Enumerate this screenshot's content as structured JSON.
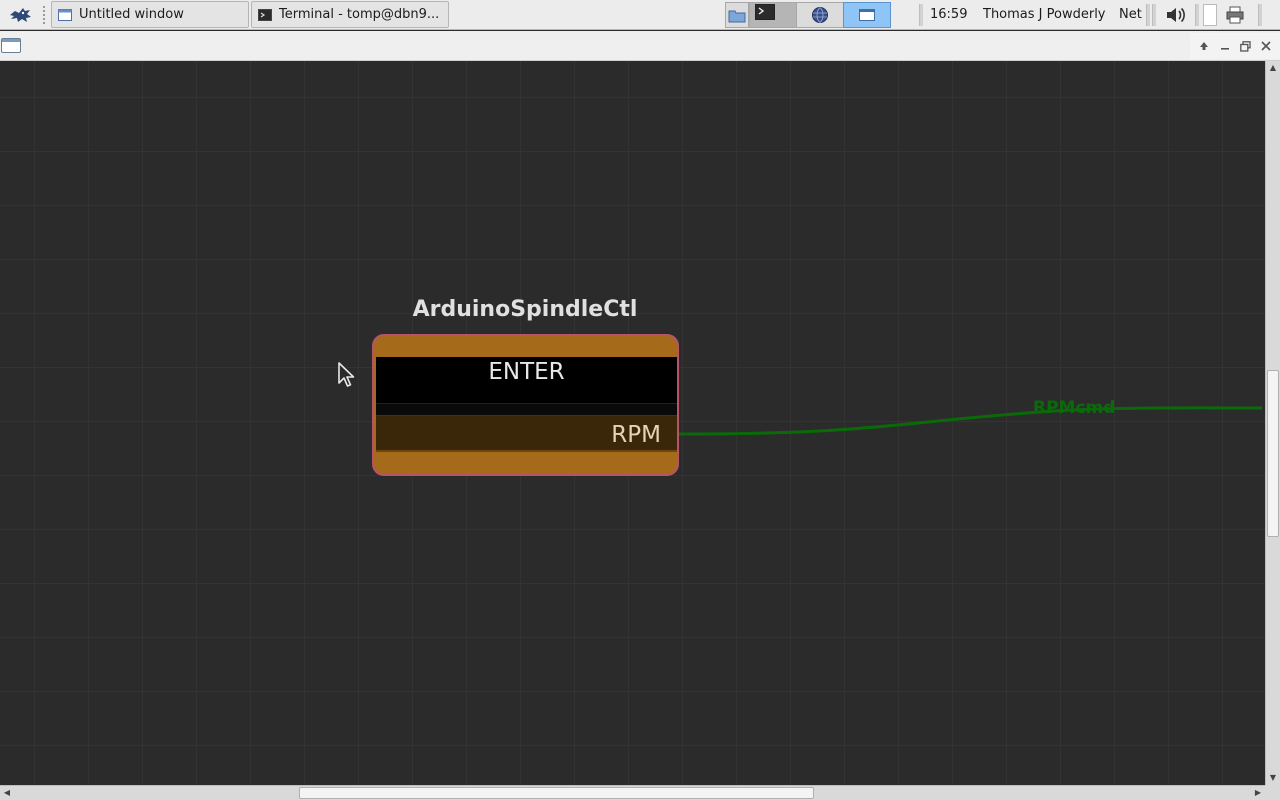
{
  "taskbar": {
    "app_menu_icon": "mouse-logo-icon",
    "tasks": [
      {
        "label": "Untitled window",
        "icon": "window-icon"
      },
      {
        "label": "Terminal - tomp@dbn9...",
        "icon": "terminal-icon"
      }
    ],
    "pager": {
      "workspaces": [
        {
          "icon": "folder-icon",
          "active": false
        },
        {
          "icon": "terminal-icon",
          "active": false
        },
        {
          "icon": "globe-icon",
          "active": false
        },
        {
          "icon": "window-icon",
          "active": true
        }
      ]
    },
    "clock": "16:59",
    "user": "Thomas J Powderly",
    "net_label": "Net",
    "tray_icons": [
      "volume-icon",
      "battery-icon",
      "printer-icon"
    ]
  },
  "window": {
    "controls": [
      "raise-icon",
      "minimize-icon",
      "maximize-icon",
      "close-icon"
    ]
  },
  "canvas": {
    "background": "#2b2b2b",
    "node": {
      "title": "ArduinoSpindleCtl",
      "enter_label": "ENTER",
      "output_label": "RPM",
      "body_color": "#a56a1a",
      "border_color": "#b8546a"
    },
    "wire": {
      "label": "RPMcmd",
      "color": "#0a6a0a"
    }
  }
}
